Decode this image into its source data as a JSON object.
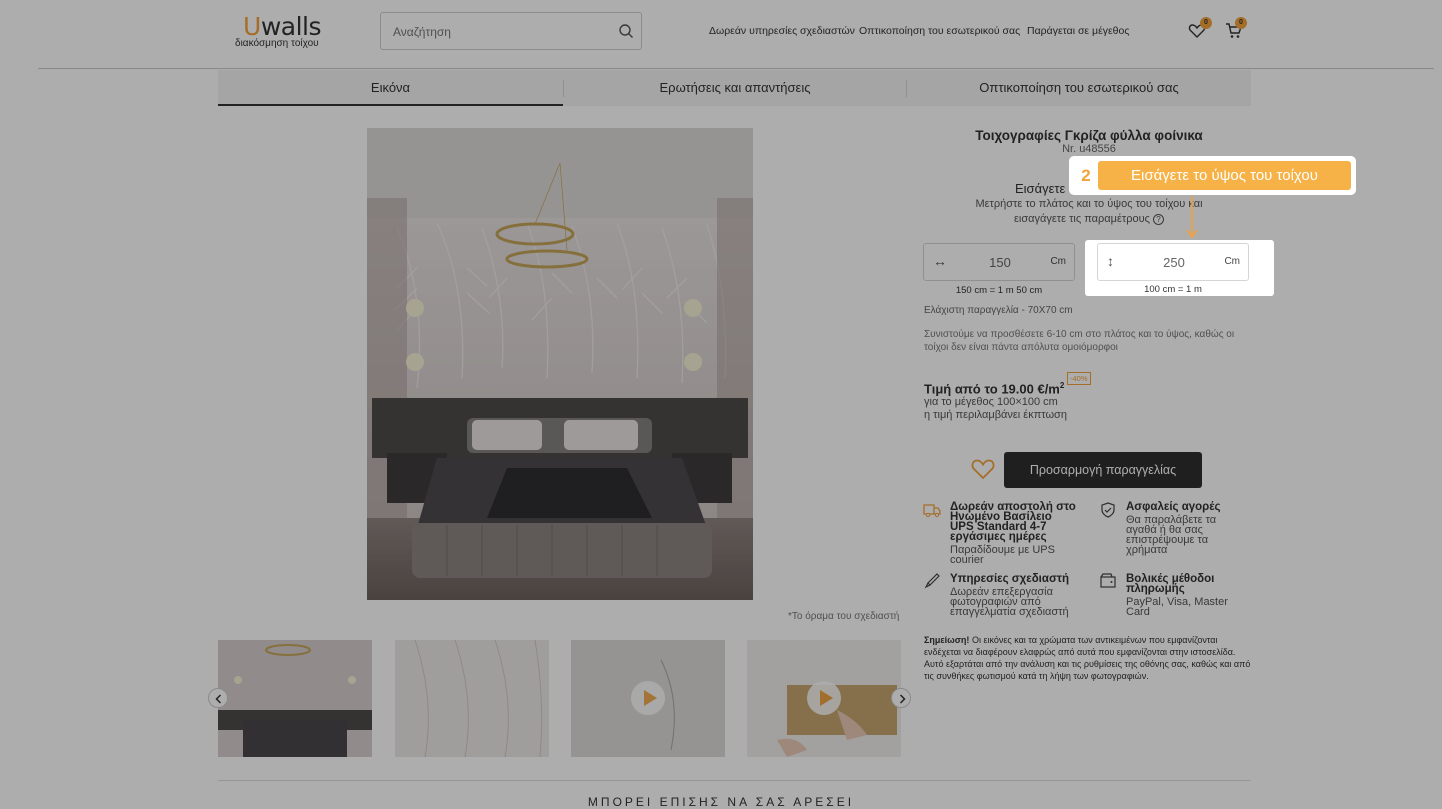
{
  "header": {
    "logo_main": "walls",
    "logo_letter": "U",
    "logo_tagline": "διακόσμηση τοίχου",
    "search_placeholder": "Αναζήτηση",
    "links": [
      "Δωρεάν υπηρεσίες σχεδιαστών",
      "Οπτικοποίηση του εσωτερικού σας",
      "Παράγεται σε μέγεθος"
    ],
    "wishlist_count": "0",
    "cart_count": "0",
    "icons": {
      "search": "search-icon",
      "wishlist": "heart-icon",
      "cart": "cart-icon"
    }
  },
  "tabs": [
    "Εικόνα",
    "Ερωτήσεις και απαντήσεις",
    "Οπτικοποίηση του εσωτερικού σας"
  ],
  "active_tab": "Εικόνα",
  "gallery": {
    "caption": "*Το όραμα του σχεδιαστή",
    "thumbnails": [
      "bedroom",
      "palm-leaves",
      "wall-video",
      "install-video"
    ]
  },
  "product": {
    "title": "Τοιχογραφίες Γκρίζα φύλλα φοίνικα",
    "sku": "Nr. u48556",
    "enter_label": "Εισάγετε",
    "measure_line1": "Μετρήστε το πλάτος και το ύψος του τοίχου και",
    "measure_line2": "εισαγάγετε τις παραμέτρους",
    "help_icon": "?",
    "width": {
      "value": "150",
      "unit": "Cm",
      "symbol": "↔",
      "conversion": "150 cm = 1 m 50 cm"
    },
    "height": {
      "value": "250",
      "unit": "Cm",
      "symbol": "↕",
      "conversion": "100 cm = 1 m"
    },
    "min_order": "Ελάχιστη παραγγελία - 70X70 cm",
    "recommendation": "Συνιστούμε να προσθέσετε 6-10 cm στο πλάτος και το ύψος, καθώς οι τοίχοι δεν είναι πάντα απόλυτα ομοιόμορφοι",
    "price_label": "Τιμή από το 19.00 €/m",
    "price_sup": "2",
    "discount": "-40%",
    "price_note1": "για το μέγεθος 100×100 cm",
    "price_note2": "η τιμή περιλαμβάνει έκπτωση",
    "order_button": "Προσαρμογή παραγγελίας"
  },
  "features": [
    {
      "icon": "truck-icon",
      "title_lines": [
        "Δωρεάν αποστολή στο",
        "Ηνωμένο Βασίλειο",
        "UPS Standard 4-7",
        "εργάσιμες ημέρες"
      ],
      "sub_lines": [
        "Παραδίδουμε με UPS",
        "courier"
      ]
    },
    {
      "icon": "shield-icon",
      "title_lines": [
        "Ασφαλείς αγορές"
      ],
      "sub_lines": [
        "Θα παραλάβετε τα",
        "αγαθά ή θα σας",
        "επιστρέψουμε τα",
        "χρήματα"
      ]
    },
    {
      "icon": "brush-icon",
      "title_lines": [
        "Υπηρεσίες σχεδιαστή"
      ],
      "sub_lines": [
        "Δωρεάν επεξεργασία",
        "φωτογραφιών από",
        "επαγγελματία σχεδιαστή"
      ]
    },
    {
      "icon": "wallet-icon",
      "title_lines": [
        "Βολικές μέθοδοι",
        "πληρωμής"
      ],
      "sub_lines": [
        "PayPal, Visa, Master",
        "Card"
      ]
    }
  ],
  "note": {
    "bold": "Σημείωση!",
    "text": " Οι εικόνες και τα χρώματα των αντικειμένων που εμφανίζονται ενδέχεται να διαφέρουν ελαφρώς από αυτά που εμφανίζονται στην ιστοσελίδα. Αυτό εξαρτάται από την ανάλυση και τις ρυθμίσεις της οθόνης σας, καθώς και από τις συνθήκες φωτισμού κατά τη λήψη των φωτογραφιών."
  },
  "also_like": "ΜΠΟΡΕΙ ΕΠΙΣΗΣ ΝΑ ΣΑΣ ΑΡΕΣΕΙ",
  "tutorial": {
    "step": "2",
    "text": "Εισάγετε το ύψος του τοίχου"
  },
  "colors": {
    "accent": "#f4a23c",
    "button": "#2e2e2e",
    "tip": "#f6b246"
  }
}
